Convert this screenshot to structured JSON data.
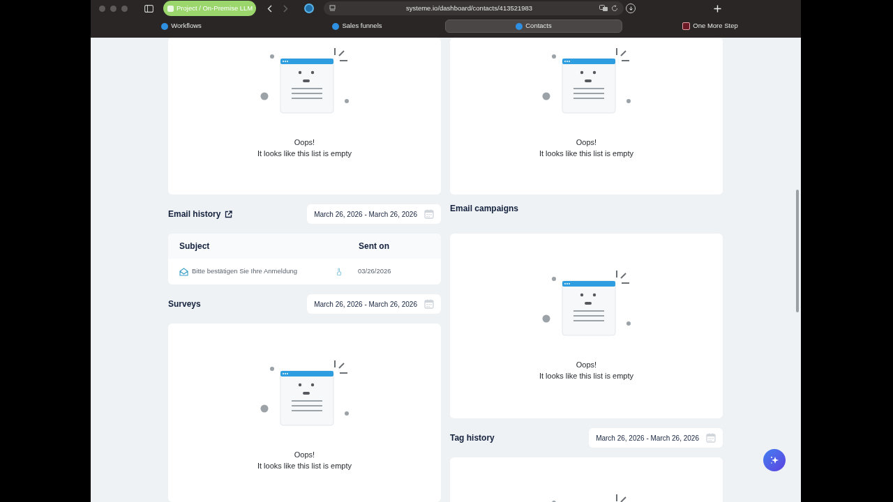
{
  "browser": {
    "tab_group": "Project / On-Premise LLM",
    "url": "systeme.io/dashboard/contacts/413521983",
    "tabs": [
      {
        "label": "Workflows",
        "kind": "systeme",
        "selected": false
      },
      {
        "label": "Sales funnels",
        "kind": "systeme",
        "selected": false
      },
      {
        "label": "Contacts",
        "kind": "systeme",
        "selected": true
      },
      {
        "label": "One More Step",
        "kind": "external",
        "selected": false
      }
    ]
  },
  "columns": [
    [
      {
        "kind": "empty_card",
        "heading": "Oops!",
        "message": "It looks like this list is empty"
      },
      {
        "kind": "header",
        "title": "Email history",
        "link_icon": true,
        "date_range": "March 26, 2026 - March 26, 2026"
      },
      {
        "kind": "table_card",
        "columns": [
          "Subject",
          "Sent on"
        ],
        "rows": [
          {
            "subject": "Bitte bestätigen Sie Ihre Anmeldung",
            "sent_on": "03/26/2026"
          }
        ]
      },
      {
        "kind": "header",
        "title": "Surveys",
        "link_icon": false,
        "date_range": "March 26, 2026 - March 26, 2026"
      },
      {
        "kind": "empty_card",
        "heading": "Oops!",
        "message": "It looks like this list is empty"
      }
    ],
    [
      {
        "kind": "empty_card",
        "heading": "Oops!",
        "message": "It looks like this list is empty"
      },
      {
        "kind": "header",
        "title": "Email campaigns",
        "link_icon": false
      },
      {
        "kind": "empty_card",
        "heading": "Oops!",
        "message": "It looks like this list is empty"
      },
      {
        "kind": "header",
        "title": "Tag history",
        "link_icon": false,
        "date_range": "March 26, 2026 - March 26, 2026"
      },
      {
        "kind": "empty_card"
      }
    ]
  ]
}
